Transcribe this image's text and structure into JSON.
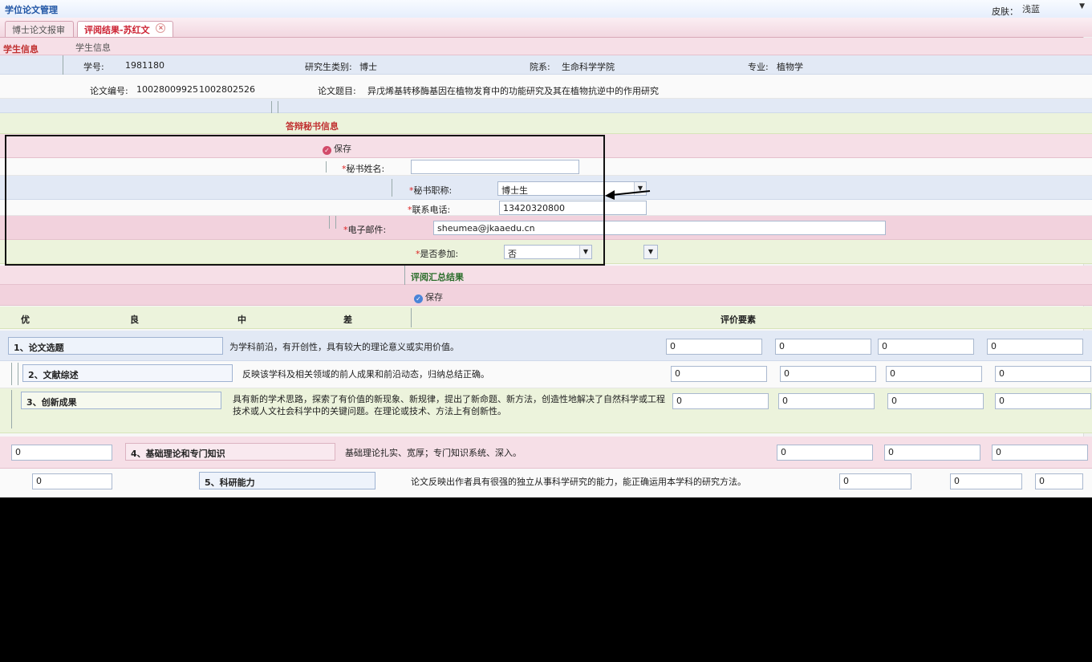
{
  "app": {
    "title": "学位论文管理"
  },
  "skin": {
    "label": "皮肤：",
    "value": "浅蓝"
  },
  "tabs": [
    {
      "label": "博士论文报审"
    },
    {
      "label": "评阅结果-苏红文"
    }
  ],
  "student_section": {
    "title": "学生信息",
    "subtitle": "学生信息",
    "student_no_label": "学号:",
    "student_no": "1981180",
    "type_label": "研究生类别:",
    "type_value": "博士",
    "dept_label": "院系:",
    "dept_value": "生命科学学院",
    "major_label": "专业:",
    "major_value": "植物学",
    "thesis_no_label": "论文编号:",
    "thesis_no": "10028009925",
    "thesis_no_2": "1002802526",
    "topic_label": "论文题目:",
    "topic_value": "异戊烯基转移酶基因在植物发育中的功能研究及其在植物抗逆中的作用研究"
  },
  "secretary": {
    "title": "答辩秘书信息",
    "save_label": "保存",
    "name_label": "秘书姓名:",
    "name_value": "",
    "title_label": "秘书职称:",
    "title_value": "博士生",
    "phone_label": "联系电话:",
    "phone_value": "13420320800",
    "email_label": "电子邮件:",
    "email_value": "sheumea@jkaaedu.cn",
    "decision_label": "是否参加:",
    "decision_value": "否"
  },
  "summary": {
    "title": "评阅汇总结果",
    "save_label": "保存"
  },
  "grid": {
    "grades": [
      "优",
      "良",
      "中",
      "差"
    ],
    "criteria_header": "评价要素",
    "rows": [
      {
        "name": "1、论文选题",
        "desc": "为学科前沿，有开创性，具有较大的理论意义或实用价值。",
        "scores": [
          "0",
          "0",
          "0",
          "0"
        ]
      },
      {
        "name": "2、文献综述",
        "desc": "反映该学科及相关领域的前人成果和前沿动态，归纳总结正确。",
        "scores": [
          "0",
          "0",
          "0",
          "0"
        ]
      },
      {
        "name": "3、创新成果",
        "desc": "具有新的学术思路，探索了有价值的新现象、新规律，提出了新命题、新方法，创造性地解决了自然科学或工程技术或人文社会科学中的关键问题。在理论或技术、方法上有创新性。",
        "scores": [
          "0",
          "0",
          "0",
          "0"
        ]
      },
      {
        "name": "4、基础理论和专门知识",
        "desc": "基础理论扎实、宽厚；专门知识系统、深入。",
        "scores": [
          "0",
          "0",
          "0",
          "0"
        ]
      },
      {
        "name": "5、科研能力",
        "desc": "论文反映出作者具有很强的独立从事科学研究的能力，能正确运用本学科的研究方法。",
        "scores": [
          "0",
          "0",
          "0",
          "0"
        ]
      }
    ]
  }
}
